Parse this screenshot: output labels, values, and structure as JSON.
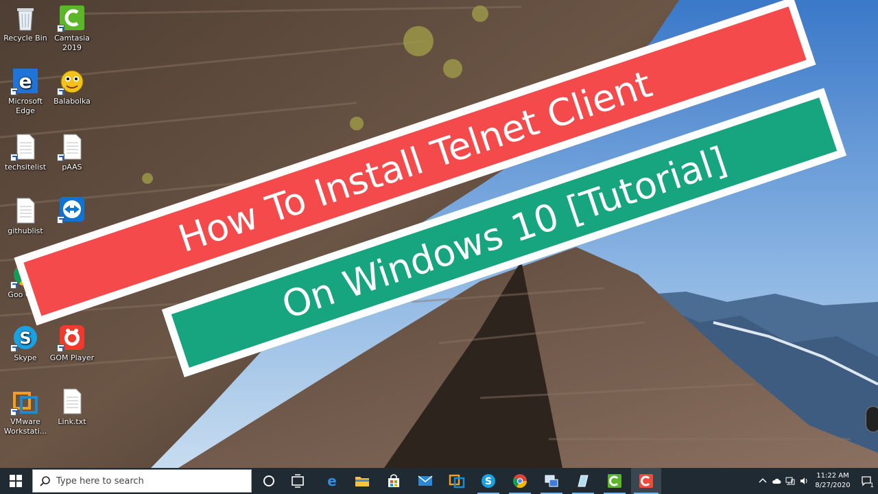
{
  "desktop": {
    "icons": [
      {
        "label": "Recycle Bin",
        "icon": "recycle-bin-icon"
      },
      {
        "label": "Camtasia 2019",
        "icon": "camtasia-icon"
      },
      {
        "label": "Microsoft Edge",
        "icon": "edge-icon"
      },
      {
        "label": "Balabolka",
        "icon": "balabolka-icon"
      },
      {
        "label": "techsitelist",
        "icon": "text-file-icon"
      },
      {
        "label": "pAAS",
        "icon": "text-file-icon"
      },
      {
        "label": "githublist",
        "icon": "text-file-icon"
      },
      {
        "label": "",
        "icon": "teamviewer-icon"
      },
      {
        "label": "Goo Chro",
        "icon": "chrome-icon"
      },
      {
        "label": "Skype",
        "icon": "skype-icon"
      },
      {
        "label": "GOM Player",
        "icon": "gom-player-icon"
      },
      {
        "label": "VMware Workstati...",
        "icon": "vmware-icon"
      },
      {
        "label": "Link.txt",
        "icon": "text-file-icon"
      }
    ]
  },
  "banner": {
    "line1": "How To Install Telnet Client",
    "line2": "On Windows 10 [Tutorial]",
    "colors": {
      "line1_bg": "#f44a4c",
      "line2_bg": "#17a57f",
      "border": "#ffffff"
    }
  },
  "taskbar": {
    "search_placeholder": "Type here to search",
    "apps": [
      "task-view-icon",
      "edge-icon",
      "file-explorer-icon",
      "store-icon",
      "mail-icon",
      "vmware-icon",
      "skype-icon",
      "chrome-icon",
      "network-app-icon",
      "glass-app-icon",
      "camtasia-icon",
      "camtasia-recorder-icon"
    ],
    "tray": {
      "time": "11:22 AM",
      "date": "8/27/2020",
      "notification_count": "1"
    }
  }
}
